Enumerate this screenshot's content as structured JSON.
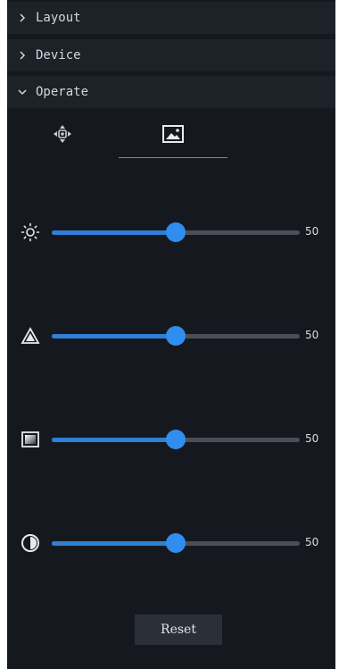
{
  "sections": {
    "layout": {
      "label": "Layout",
      "expanded": false
    },
    "device": {
      "label": "Device",
      "expanded": false
    },
    "operate": {
      "label": "Operate",
      "expanded": true
    }
  },
  "tabs": [
    {
      "icon": "ptz-direction-icon",
      "active": false
    },
    {
      "icon": "image-icon",
      "active": true
    }
  ],
  "sliders": [
    {
      "icon": "brightness-icon",
      "value": "50",
      "fraction": 0.5
    },
    {
      "icon": "sharpness-icon",
      "value": "50",
      "fraction": 0.5
    },
    {
      "icon": "saturation-icon",
      "value": "50",
      "fraction": 0.5
    },
    {
      "icon": "contrast-icon",
      "value": "50",
      "fraction": 0.5
    }
  ],
  "reset_label": "Reset",
  "colors": {
    "panel_bg": "#15191f",
    "header_bg": "#1d2128",
    "accent": "#2f8ef0",
    "tab_underline": "#3aa0b5"
  }
}
